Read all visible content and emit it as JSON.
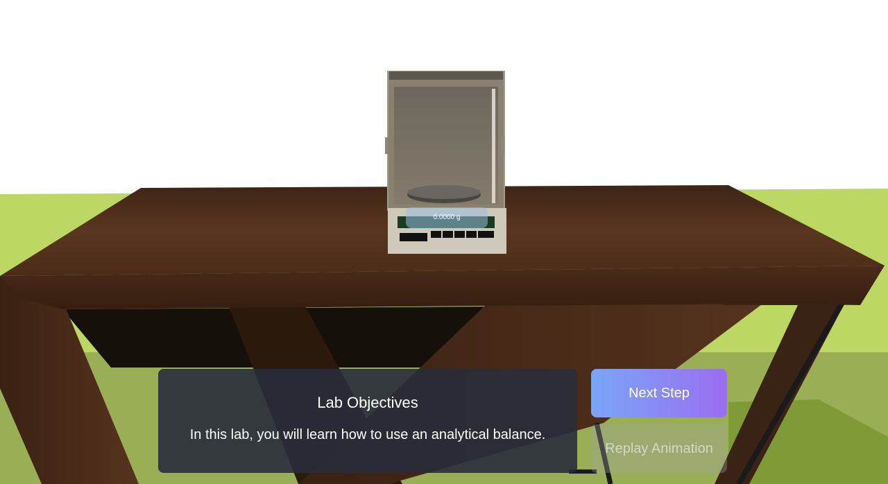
{
  "balance": {
    "reading": "0.0000 g"
  },
  "objectives": {
    "title": "Lab Objectives",
    "text": "In this lab, you will learn how to use an analytical balance."
  },
  "buttons": {
    "next_step": "Next Step",
    "replay_animation": "Replay Animation"
  },
  "colors": {
    "sky": "#ffffff",
    "grass": "#bcd763",
    "table_wood": "#4a2c1a",
    "panel_bg": "#282c3a",
    "button_gradient_start": "#7aa6f6",
    "button_gradient_end": "#9b6df2"
  }
}
